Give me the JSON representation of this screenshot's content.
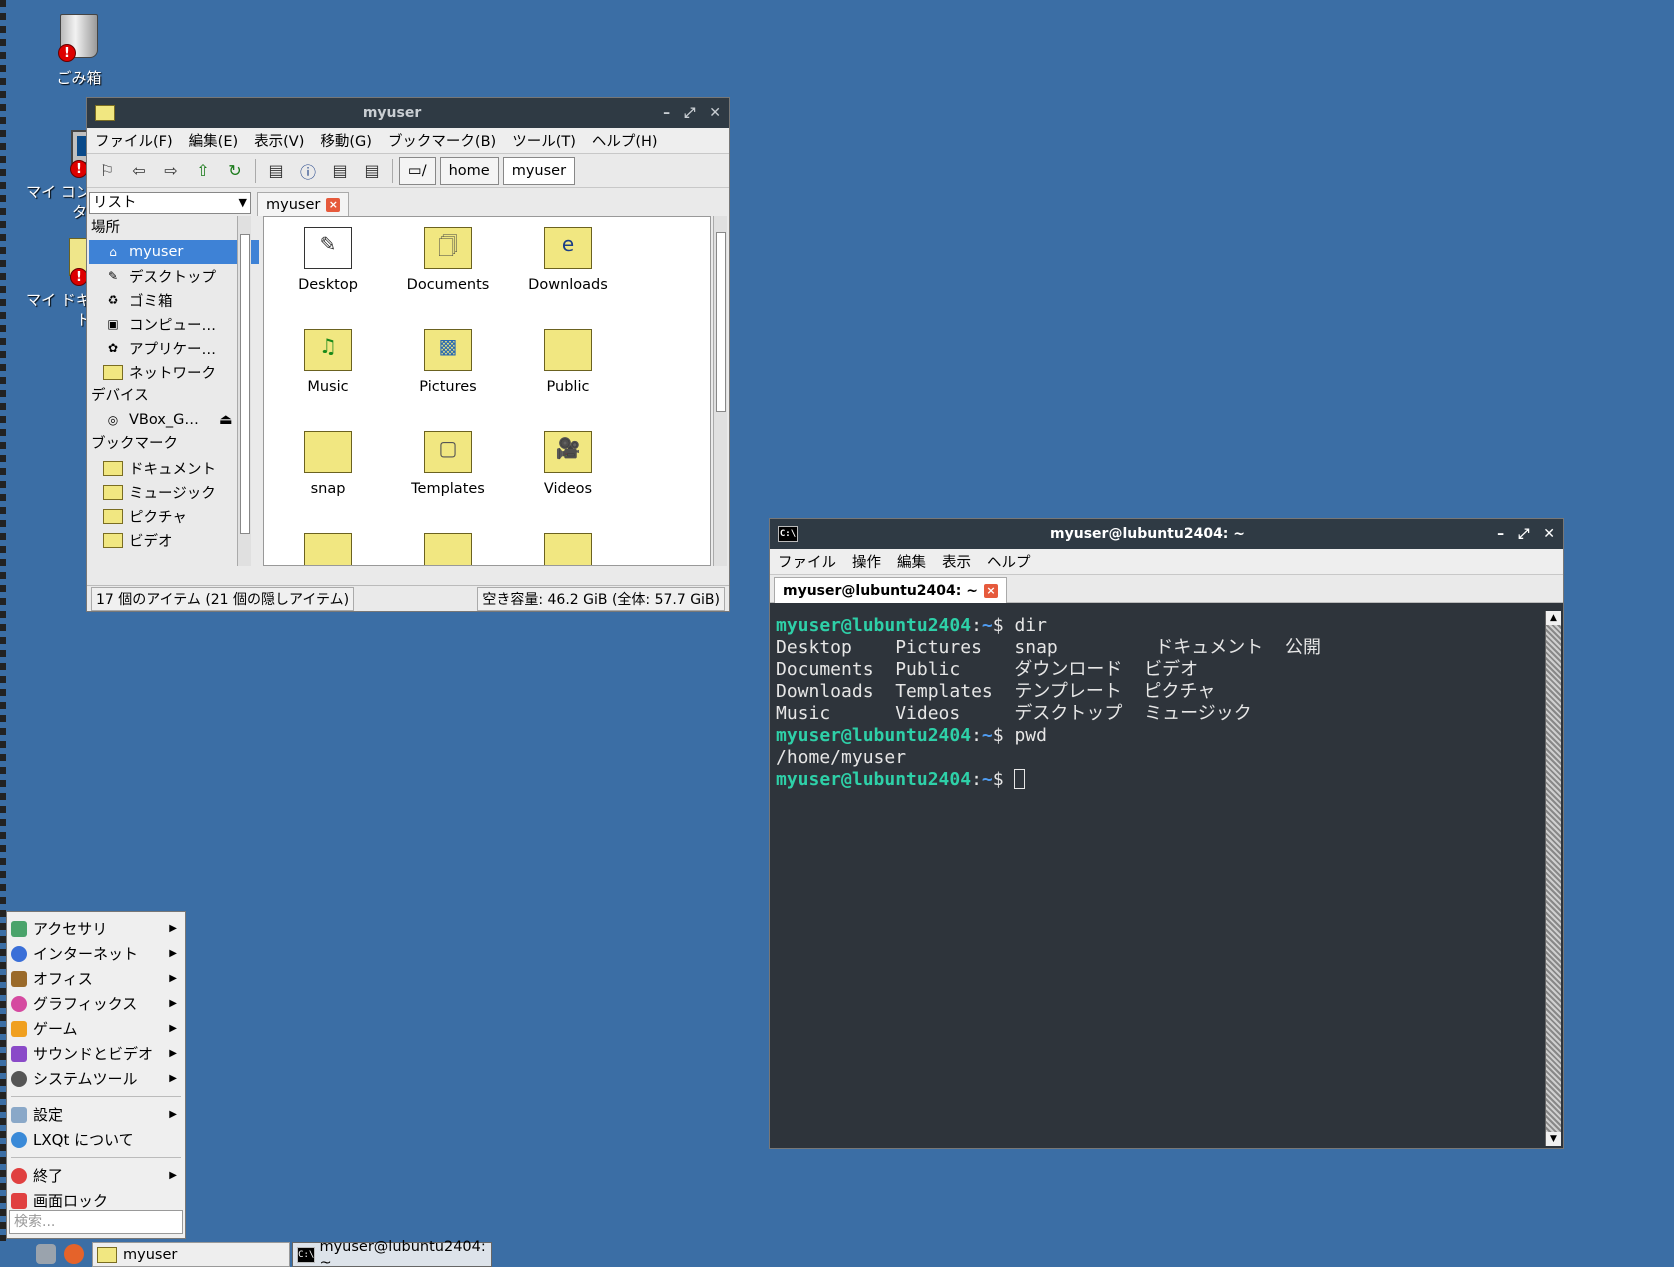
{
  "desktop": {
    "icons": [
      {
        "label": "ごみ箱",
        "icon": "trash-icon"
      },
      {
        "label_1": "マイ コン",
        "label_2": "タ",
        "icon": "computer-icon"
      },
      {
        "label_1": "マイ ドキ",
        "label_2": "ト",
        "icon": "documents-icon"
      }
    ]
  },
  "fm": {
    "title": "myuser",
    "menu": [
      "ファイル(F)",
      "編集(E)",
      "表示(V)",
      "移動(G)",
      "ブックマーク(B)",
      "ツール(T)",
      "ヘルプ(H)"
    ],
    "path_root": "/",
    "path": [
      "home",
      "myuser"
    ],
    "side_mode": "リスト",
    "tab_label": "myuser",
    "sections": {
      "places": "場所",
      "devices": "デバイス",
      "bookmarks": "ブックマーク"
    },
    "places": [
      "myuser",
      "デスクトップ",
      "ゴミ箱",
      "コンピュー…",
      "アプリケー…",
      "ネットワーク"
    ],
    "devices": [
      "VBox_G…"
    ],
    "bookmarks": [
      "ドキュメント",
      "ミュージック",
      "ピクチャ",
      "ビデオ"
    ],
    "files": [
      "Desktop",
      "Documents",
      "Downloads",
      "Music",
      "Pictures",
      "Public",
      "snap",
      "Templates",
      "Videos"
    ],
    "status_left": "17 個のアイテム (21 個の隠しアイテム)",
    "status_right": "空き容量: 46.2 GiB (全体: 57.7 GiB)"
  },
  "term": {
    "title": "myuser@lubuntu2404: ~",
    "menu": [
      "ファイル",
      "操作",
      "編集",
      "表示",
      "ヘルプ"
    ],
    "tab_label": "myuser@lubuntu2404: ~",
    "prompt_user": "myuser@lubuntu2404",
    "prompt_path": "~",
    "prompt_sep": ":",
    "prompt_end": "$ ",
    "cmd1": "dir",
    "dir_rows": [
      "Desktop    Pictures   snap         ドキュメント  公開",
      "Documents  Public     ダウンロード  ビデオ",
      "Downloads  Templates  テンプレート  ピクチャ",
      "Music      Videos     デスクトップ  ミュージック"
    ],
    "cmd2": "pwd",
    "out2": "/home/myuser"
  },
  "startmenu": {
    "items": [
      "アクセサリ",
      "インターネット",
      "オフィス",
      "グラフィックス",
      "ゲーム",
      "サウンドとビデオ",
      "システムツール"
    ],
    "items2": [
      "設定",
      "LXQt について"
    ],
    "items3": [
      "終了",
      "画面ロック"
    ],
    "search_placeholder": "検索..."
  },
  "taskbar": {
    "fm_task": "myuser",
    "term_task": "myuser@lubuntu2404: ~"
  }
}
